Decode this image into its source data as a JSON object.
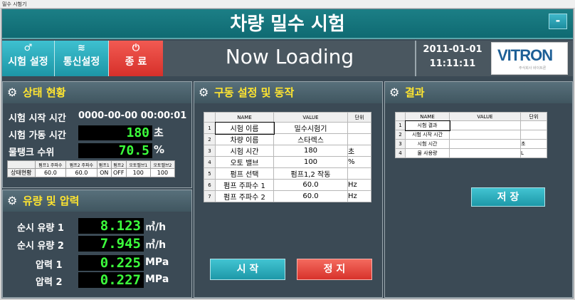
{
  "window": {
    "title": "밀수 시험기"
  },
  "header": {
    "title": "차량 밀수 시험",
    "min_label": "-"
  },
  "toolbar": {
    "test_settings": {
      "icon": "♂",
      "label": "시험 설정"
    },
    "comm_settings": {
      "icon": "≋",
      "label": "통신설정"
    },
    "exit": {
      "icon": "⏻",
      "label": "종 료"
    }
  },
  "status_text": "Now Loading",
  "datetime": {
    "date": "2011-01-01",
    "time": "11:11:11"
  },
  "logo": {
    "text": "VITRON",
    "sub": "주식회사 바이트론"
  },
  "status_panel": {
    "title": "상태 현황",
    "start_time_label": "시험 시작 시간",
    "start_time_value": "0000-00-00  00:00:01",
    "run_time_label": "시험 가동 시간",
    "run_time_value": "180",
    "run_time_unit": "초",
    "tank_label": "물탱크 수위",
    "tank_value": "70.5",
    "tank_unit": "%",
    "mini_table": {
      "headers": [
        "",
        "펌프1 주파수",
        "펌프2 주파수",
        "펌프1",
        "펌프2",
        "오토밸브1",
        "오토밸브2"
      ],
      "row_label": "상태현황",
      "values": [
        "60.0",
        "60.0",
        "ON",
        "OFF",
        "100",
        "100"
      ]
    }
  },
  "flow_panel": {
    "title": "유량 및 압력",
    "rows": [
      {
        "label": "순시 유량 1",
        "value": "8.123",
        "unit": "㎥/h"
      },
      {
        "label": "순시 유량 2",
        "value": "7.945",
        "unit": "㎥/h"
      },
      {
        "label": "압력 1",
        "value": "0.225",
        "unit": "MPa"
      },
      {
        "label": "압력 2",
        "value": "0.227",
        "unit": "MPa"
      }
    ]
  },
  "drive_panel": {
    "title": "구동 설정 및 동작",
    "headers": [
      "",
      "NAME",
      "VALUE",
      "단위"
    ],
    "rows": [
      {
        "n": "1",
        "name": "시험 이름",
        "value": "밀수시험기",
        "unit": ""
      },
      {
        "n": "2",
        "name": "차량 이름",
        "value": "스타렉스",
        "unit": ""
      },
      {
        "n": "3",
        "name": "시험 시간",
        "value": "180",
        "unit": "초"
      },
      {
        "n": "4",
        "name": "오토 밸브",
        "value": "100",
        "unit": "%"
      },
      {
        "n": "5",
        "name": "펌프 선택",
        "value": "펌프1,2 작동",
        "unit": ""
      },
      {
        "n": "6",
        "name": "펌프 주파수 1",
        "value": "60.0",
        "unit": "Hz"
      },
      {
        "n": "7",
        "name": "펌프 주파수 2",
        "value": "60.0",
        "unit": "Hz"
      }
    ],
    "start_label": "시 작",
    "stop_label": "정 지"
  },
  "result_panel": {
    "title": "결과",
    "headers": [
      "",
      "NAME",
      "VALUE",
      "단위"
    ],
    "rows": [
      {
        "n": "1",
        "name": "시험 결과",
        "value": "",
        "unit": ""
      },
      {
        "n": "2",
        "name": "시험 시작 시간",
        "value": "",
        "unit": ""
      },
      {
        "n": "3",
        "name": "시험 시간",
        "value": "",
        "unit": "초"
      },
      {
        "n": "4",
        "name": "물 사용량",
        "value": "",
        "unit": "L"
      }
    ],
    "save_label": "저 장"
  }
}
